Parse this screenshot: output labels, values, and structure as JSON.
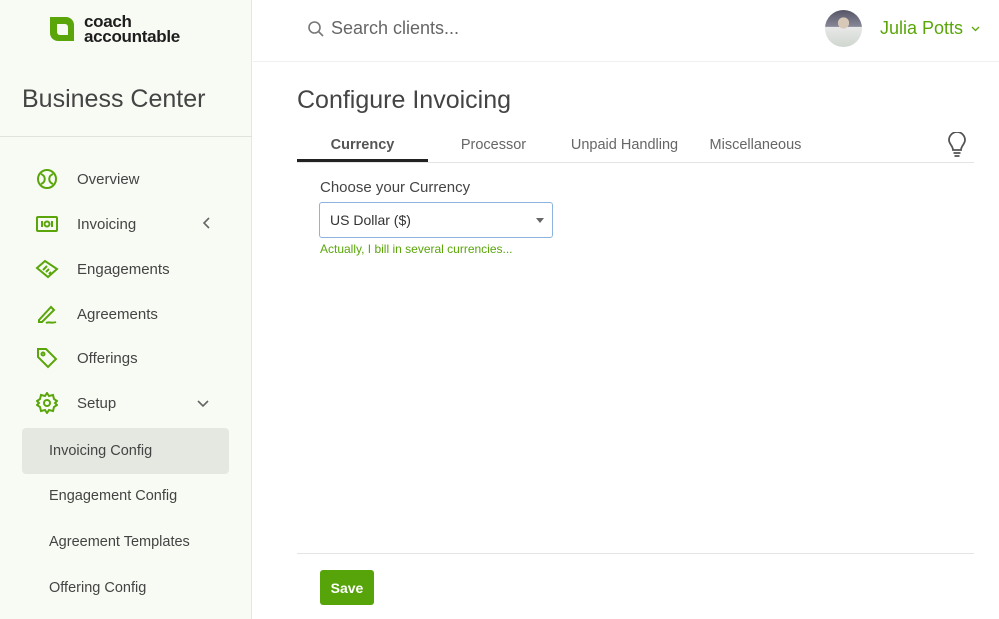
{
  "brand": {
    "logo_line1": "coach",
    "logo_line2": "accountable",
    "accent_color": "#5aa60a",
    "primary_button_color": "#56a40a"
  },
  "sidebar": {
    "title": "Business Center",
    "items": [
      {
        "label": "Overview",
        "icon": "overview-icon"
      },
      {
        "label": "Invoicing",
        "icon": "invoice-icon",
        "chevron": "chevron-left"
      },
      {
        "label": "Engagements",
        "icon": "handshake-icon"
      },
      {
        "label": "Agreements",
        "icon": "pen-icon"
      },
      {
        "label": "Offerings",
        "icon": "tag-icon"
      },
      {
        "label": "Setup",
        "icon": "gear-icon",
        "chevron": "chevron-down"
      }
    ],
    "sub_items": [
      {
        "label": "Invoicing Config",
        "active": true
      },
      {
        "label": "Engagement Config"
      },
      {
        "label": "Agreement Templates"
      },
      {
        "label": "Offering Config"
      }
    ]
  },
  "topbar": {
    "search_placeholder": "Search clients...",
    "user_name": "Julia Potts"
  },
  "main": {
    "title": "Configure Invoicing",
    "tabs": [
      {
        "label": "Currency",
        "active": true
      },
      {
        "label": "Processor"
      },
      {
        "label": "Unpaid Handling"
      },
      {
        "label": "Miscellaneous"
      }
    ],
    "currency_label": "Choose your Currency",
    "currency_value": "US Dollar ($)",
    "multi_currency_link": "Actually, I bill in several currencies...",
    "save_label": "Save"
  }
}
